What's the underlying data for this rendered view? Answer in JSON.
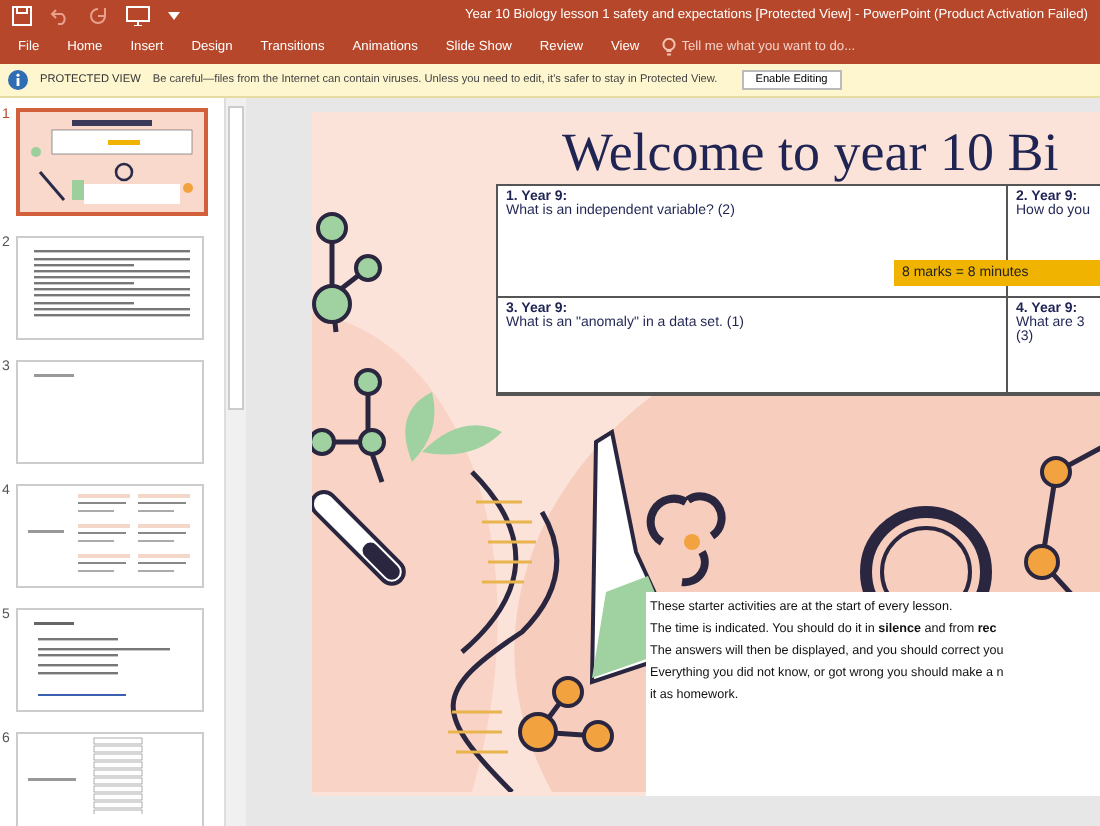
{
  "window": {
    "title": "Year 10 Biology lesson 1 safety and expectations [Protected View] - PowerPoint (Product Activation Failed)"
  },
  "ribbon_tabs": [
    {
      "label": "File"
    },
    {
      "label": "Home"
    },
    {
      "label": "Insert"
    },
    {
      "label": "Design"
    },
    {
      "label": "Transitions"
    },
    {
      "label": "Animations"
    },
    {
      "label": "Slide Show"
    },
    {
      "label": "Review"
    },
    {
      "label": "View"
    }
  ],
  "tell_me": {
    "placeholder": "Tell me what you want to do..."
  },
  "protected_view": {
    "label": "PROTECTED VIEW",
    "message": "Be careful—files from the Internet can contain viruses. Unless you need to edit, it's safer to stay in Protected View.",
    "button": "Enable Editing"
  },
  "thumbnails": [
    {
      "number": "1",
      "selected": true,
      "kind": "title"
    },
    {
      "number": "2",
      "selected": false,
      "kind": "text"
    },
    {
      "number": "3",
      "selected": false,
      "kind": "blank"
    },
    {
      "number": "4",
      "selected": false,
      "kind": "table"
    },
    {
      "number": "5",
      "selected": false,
      "kind": "list"
    },
    {
      "number": "6",
      "selected": false,
      "kind": "grid"
    }
  ],
  "slide": {
    "title": "Welcome to year 10 Bi",
    "cells": [
      {
        "heading": "1.    Year 9:",
        "lines": [
          "What is an independent variable? (2)"
        ]
      },
      {
        "heading": "2. Year 9:",
        "lines": [
          "How do you"
        ]
      },
      {
        "heading": "3. Year 9:",
        "lines": [
          "What is an \"anomaly\" in a data set. (1)"
        ]
      },
      {
        "heading": "4. Year 9:",
        "lines": [
          "What are 3",
          "(3)"
        ]
      }
    ],
    "badge": "8 marks = 8 minutes",
    "notes": [
      "These starter activities are at the start of every lesson.",
      "The time is indicated. You should do it in **silence** and from **rec**",
      "The answers will then be displayed, and you should correct you",
      "Everything you did not know, or got wrong you should make a n",
      "it as homework."
    ]
  }
}
